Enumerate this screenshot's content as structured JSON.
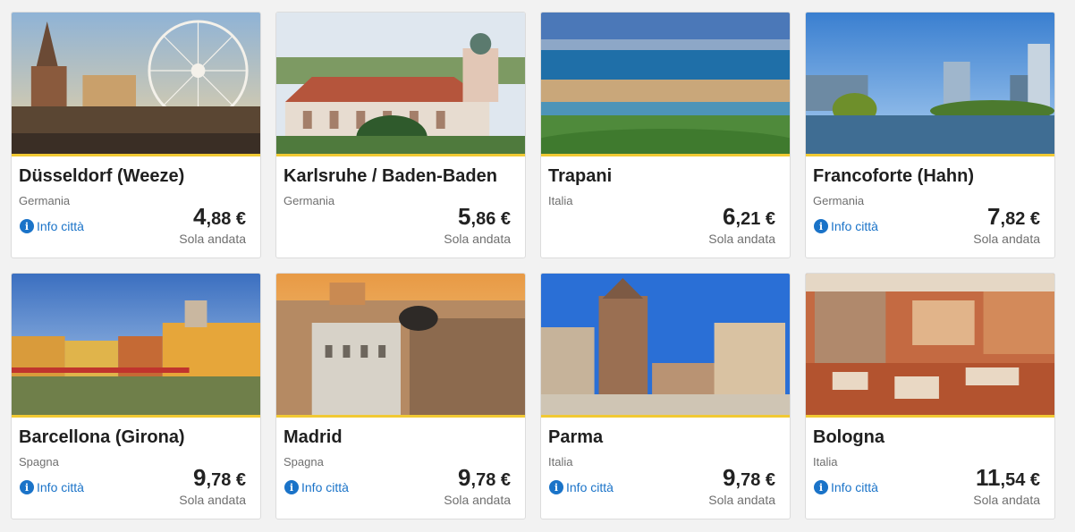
{
  "cards": [
    {
      "city": "Düsseldorf (Weeze)",
      "country": "Germania",
      "info": "Info città",
      "price_int": "4",
      "price_dec": ",88 €",
      "fare": "Sola andata",
      "show_info": true
    },
    {
      "city": "Karlsruhe / Baden-Baden",
      "country": "Germania",
      "info": "",
      "price_int": "5",
      "price_dec": ",86 €",
      "fare": "Sola andata",
      "show_info": false
    },
    {
      "city": "Trapani",
      "country": "Italia",
      "info": "",
      "price_int": "6",
      "price_dec": ",21 €",
      "fare": "Sola andata",
      "show_info": false
    },
    {
      "city": "Francoforte (Hahn)",
      "country": "Germania",
      "info": "Info città",
      "price_int": "7",
      "price_dec": ",82 €",
      "fare": "Sola andata",
      "show_info": true
    },
    {
      "city": "Barcellona (Girona)",
      "country": "Spagna",
      "info": "Info città",
      "price_int": "9",
      "price_dec": ",78 €",
      "fare": "Sola andata",
      "show_info": true
    },
    {
      "city": "Madrid",
      "country": "Spagna",
      "info": "Info città",
      "price_int": "9",
      "price_dec": ",78 €",
      "fare": "Sola andata",
      "show_info": true
    },
    {
      "city": "Parma",
      "country": "Italia",
      "info": "Info città",
      "price_int": "9",
      "price_dec": ",78 €",
      "fare": "Sola andata",
      "show_info": true
    },
    {
      "city": "Bologna",
      "country": "Italia",
      "info": "Info città",
      "price_int": "11",
      "price_dec": ",54 €",
      "fare": "Sola andata",
      "show_info": true
    }
  ],
  "colors": {
    "accent": "#f1c933",
    "link": "#1a73c8",
    "title": "#1f1f1f",
    "muted": "#6f6f6f"
  },
  "icons": {
    "info": "info-circle-icon"
  }
}
